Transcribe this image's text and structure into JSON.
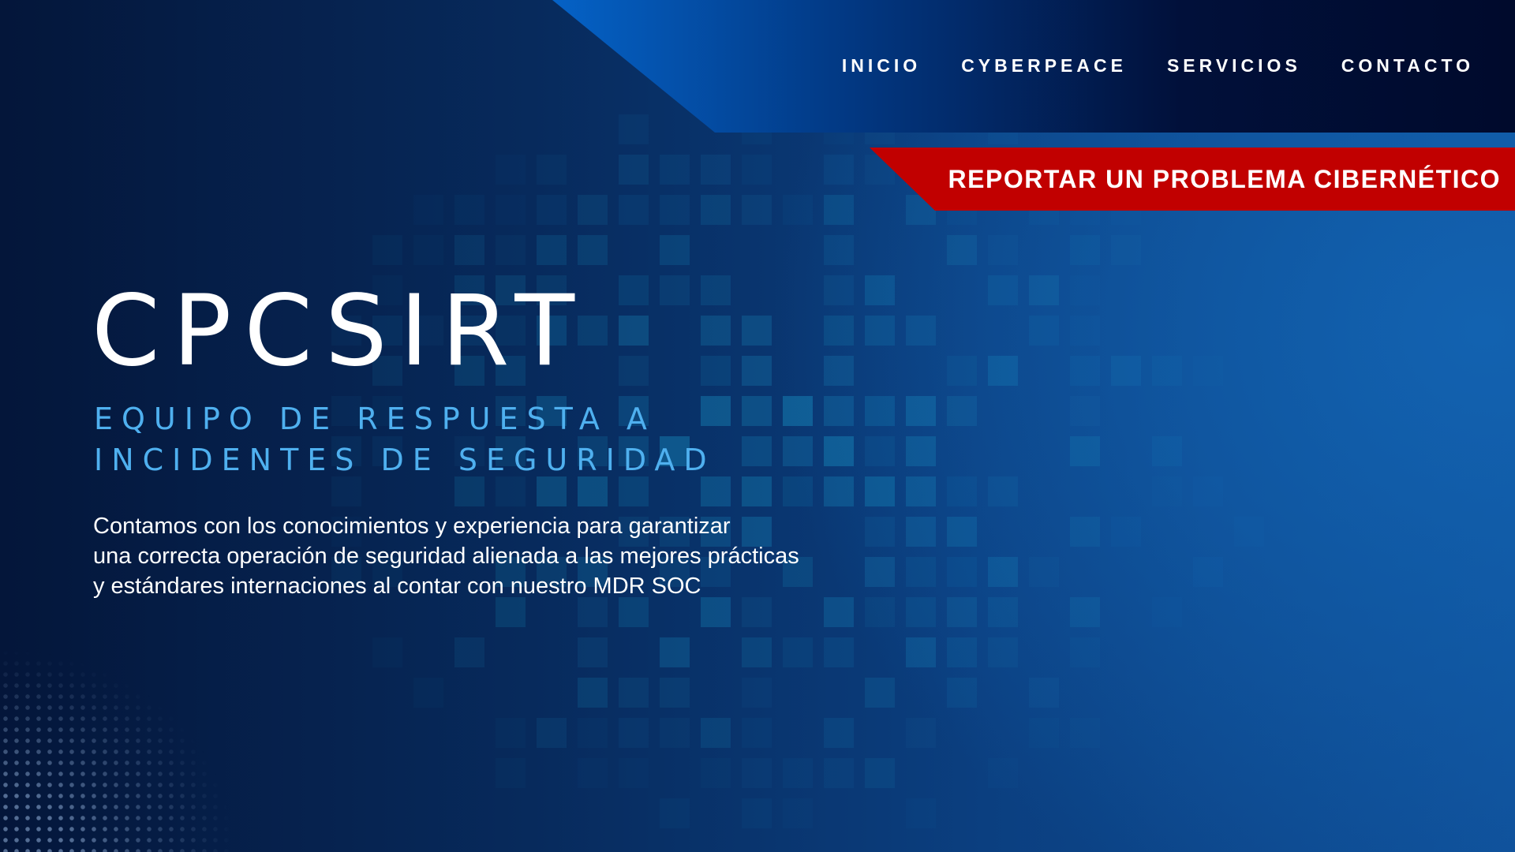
{
  "nav": {
    "items": [
      {
        "label": "INICIO"
      },
      {
        "label": "CYBERPEACE"
      },
      {
        "label": "SERVICIOS"
      },
      {
        "label": "CONTACTO"
      }
    ]
  },
  "report_button": {
    "label": "REPORTAR UN PROBLEMA CIBERNÉTICO"
  },
  "hero": {
    "title": "CPCSIRT",
    "subtitle_lines": [
      "EQUIPO DE RESPUESTA A",
      "INCIDENTES DE SEGURIDAD"
    ],
    "description_lines": [
      "Contamos con los conocimientos y experiencia para garantizar",
      "una correcta operación de seguridad alienada a las mejores prácticas",
      "y estándares internaciones al contar con nuestro MDR SOC"
    ]
  },
  "colors": {
    "accent": "#4fb0ef",
    "report": "#c10000",
    "nav_blue": "#0563c8"
  }
}
